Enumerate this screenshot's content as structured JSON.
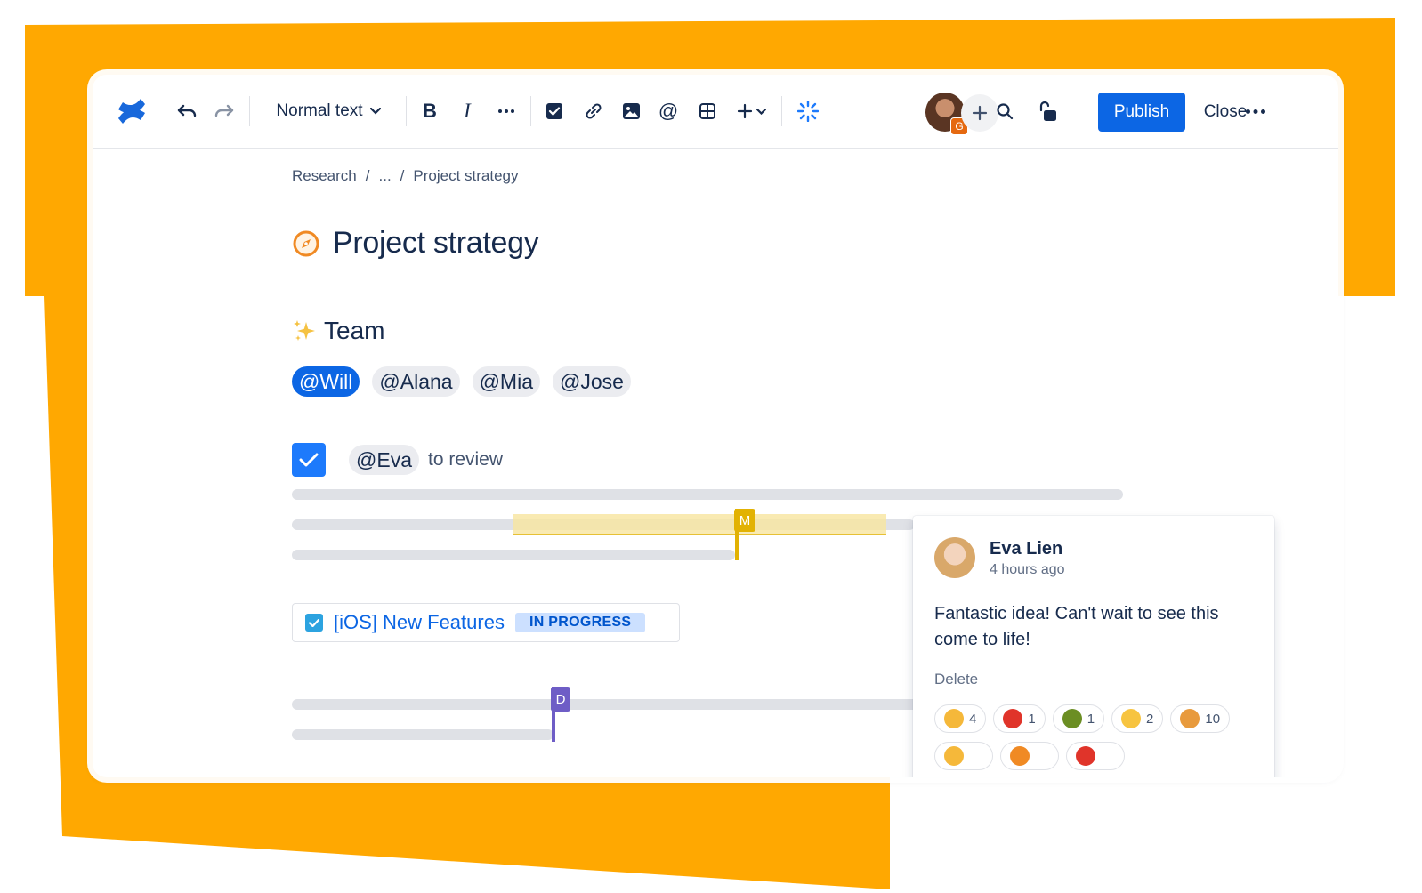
{
  "colors": {
    "accent": "#0c66e4",
    "backdrop": "#ffa801",
    "highlight": "#f8e6a0",
    "cursor_m": "#e2b203",
    "cursor_d": "#6e5dc6"
  },
  "toolbar": {
    "logo_icon": "confluence-logo",
    "text_style": "Normal text",
    "publish_label": "Publish",
    "close_label": "Close",
    "collaborator_badge": "G"
  },
  "breadcrumb": {
    "root": "Research",
    "sep": "/",
    "ellipsis": "...",
    "current": "Project strategy"
  },
  "page": {
    "title": "Project strategy",
    "title_icon": "compass-icon"
  },
  "team": {
    "heading": "Team",
    "mentions": [
      "@Will",
      "@Alana",
      "@Mia",
      "@Jose"
    ]
  },
  "task": {
    "mention": "@Eva",
    "text": "to review",
    "checked": true
  },
  "cursors": {
    "m": "M",
    "d": "D"
  },
  "jira": {
    "title": "[iOS] New Features",
    "status": "IN PROGRESS"
  },
  "comment": {
    "author": "Eva Lien",
    "time": "4 hours ago",
    "body": "Fantastic idea! Can't wait to see this come to life!",
    "delete_label": "Delete",
    "reactions": [
      {
        "emoji": "clapping-hands",
        "count": "4",
        "color": "#f5b83a"
      },
      {
        "emoji": "tomato",
        "count": "1",
        "color": "#e0342a"
      },
      {
        "emoji": "avocado",
        "count": "1",
        "color": "#6b8e23"
      },
      {
        "emoji": "astonished-face",
        "count": "2",
        "color": "#f7c440"
      },
      {
        "emoji": "pancakes",
        "count": "10",
        "color": "#e89a3c"
      }
    ]
  }
}
